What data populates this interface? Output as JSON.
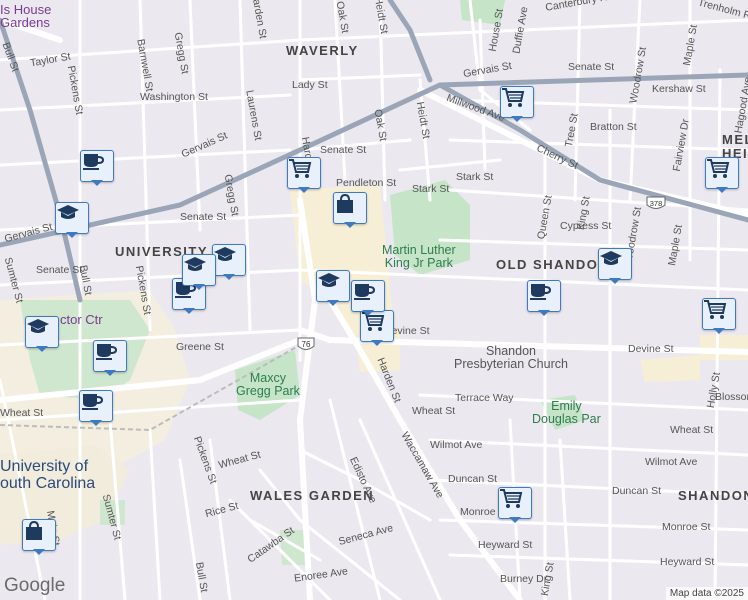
{
  "map": {
    "attribution": "Map data ©2025",
    "logo": "Google"
  },
  "labels": {
    "neighborhoods": [
      "WAVERLY",
      "UNIVERSITY H",
      "OLD SHANDON",
      "WALES GARDEN",
      "SHANDON",
      "MEL",
      "HEI"
    ],
    "parks": [
      "Martin Luther\nKing Jr Park",
      "Maxcy\nGregg Park",
      "Emily\nDouglas Par"
    ],
    "pois": [
      "Shandon\nPresbyterian Church",
      "Is House\nGardens",
      "ctor Ctr",
      "University of\nouth Carolina"
    ],
    "streets": [
      "Taylor St",
      "Gervais St",
      "Gervais St",
      "Gervais St",
      "Washington St",
      "Lady St",
      "Senate St",
      "Senate St",
      "Senate St",
      "Senate St",
      "Pendleton St",
      "Stark St",
      "Stark St",
      "Devine St",
      "Devine St",
      "Terrace Way",
      "Wheat St",
      "Wheat St",
      "Wheat St",
      "Wheat St",
      "Greene St",
      "Wilmot Ave",
      "Wilmot Ave",
      "Duncan St",
      "Duncan St",
      "Monroe St",
      "Monroe St",
      "Heyward St",
      "Heyward St",
      "Burney Dr",
      "Rice St",
      "Catawba St",
      "Seneca Ave",
      "Enoree Ave",
      "Edisto Ave",
      "Waccamaw Ave",
      "Harden St",
      "Harden St",
      "Harden St",
      "Gregg St",
      "Gregg St",
      "Laurens St",
      "Barnwell St",
      "Pickens St",
      "Pickens St",
      "Pickens St",
      "Bull St",
      "Bull St",
      "Bull St",
      "Sumter St",
      "Sumter St",
      "Main St",
      "Oak St",
      "Oak St",
      "Heidt St",
      "Heidt St",
      "Millwood Ave",
      "Bratton St",
      "Kershaw St",
      "Cherry St",
      "Cypress St",
      "Queen St",
      "King St",
      "King St",
      "Woodrow St",
      "Woodrow St",
      "Tree St",
      "Fairview Dr",
      "Maple St",
      "Maple St",
      "Hagood Ave",
      "Holly St",
      "Blossom St",
      "House St",
      "Duffie Ave",
      "Trenholm Rd",
      "Canterbury Rd",
      "Greene St",
      "Laurens St",
      "Harden St",
      "Gregg St",
      "Sumter St"
    ],
    "route_shields": [
      "76",
      "378"
    ]
  },
  "markers": [
    {
      "type": "shopping-cart",
      "label": "Grocery"
    },
    {
      "type": "shopping-cart",
      "label": "Grocery"
    },
    {
      "type": "shopping-cart",
      "label": "Grocery"
    },
    {
      "type": "shopping-cart",
      "label": "Grocery"
    },
    {
      "type": "shopping-cart",
      "label": "Grocery"
    },
    {
      "type": "shopping-cart",
      "label": "Grocery"
    },
    {
      "type": "shopping-bag",
      "label": "Shopping"
    },
    {
      "type": "shopping-bag",
      "label": "Shopping"
    },
    {
      "type": "coffee-cup",
      "label": "Cafe"
    },
    {
      "type": "coffee-cup",
      "label": "Cafe"
    },
    {
      "type": "coffee-cup",
      "label": "Cafe"
    },
    {
      "type": "coffee-cup",
      "label": "Cafe"
    },
    {
      "type": "coffee-cup",
      "label": "Cafe"
    },
    {
      "type": "coffee-cup",
      "label": "Cafe"
    },
    {
      "type": "graduation-cap",
      "label": "School"
    },
    {
      "type": "graduation-cap",
      "label": "School"
    },
    {
      "type": "graduation-cap",
      "label": "School"
    },
    {
      "type": "graduation-cap",
      "label": "School"
    },
    {
      "type": "graduation-cap",
      "label": "School"
    },
    {
      "type": "graduation-cap",
      "label": "School"
    }
  ]
}
